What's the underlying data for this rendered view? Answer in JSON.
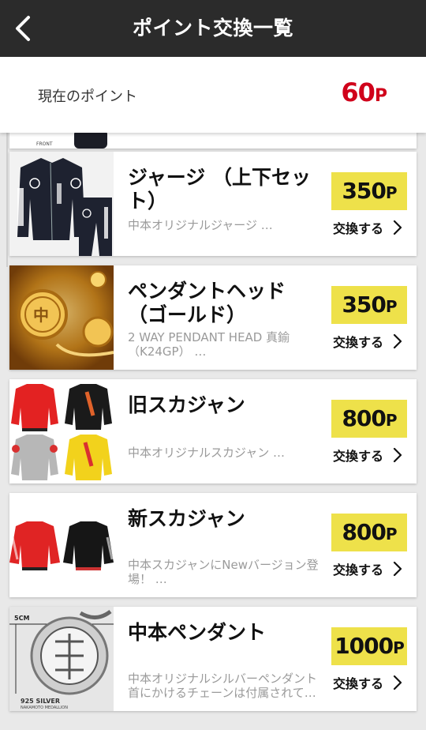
{
  "header": {
    "title": "ポイント交換一覧",
    "back_icon": "chevron-left-icon"
  },
  "points": {
    "label": "現在のポイント",
    "value": "60",
    "unit": "P"
  },
  "partial_card": {
    "label": "FRONT"
  },
  "items": [
    {
      "name": "ジャージ （上下セット）",
      "desc": "中本オリジナルジャージ …",
      "price": "350",
      "unit": "P",
      "action": "交換する"
    },
    {
      "name": "ペンダントヘッド（ゴールド）",
      "desc": "2 WAY PENDANT HEAD 真鍮（K24GP） …",
      "price": "350",
      "unit": "P",
      "action": "交換する"
    },
    {
      "name": "旧スカジャン",
      "desc": "中本オリジナルスカジャン …",
      "price": "800",
      "unit": "P",
      "action": "交換する"
    },
    {
      "name": "新スカジャン",
      "desc": "中本スカジャンにNewバージョン登場！ …",
      "price": "800",
      "unit": "P",
      "action": "交換する"
    },
    {
      "name": "中本ペンダント",
      "desc": "中本オリジナルシルバーペンダント首にかけるチェーンは付属されて…",
      "price": "1000",
      "unit": "P",
      "action": "交換する"
    }
  ],
  "thumb_labels": {
    "scale": "5CM",
    "silver": "925 SILVER",
    "medallion": "NAKAMOTO MEDALLION"
  }
}
